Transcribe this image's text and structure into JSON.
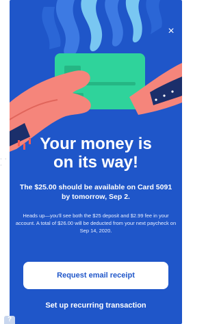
{
  "modal": {
    "close_icon": "×",
    "headline_line1": "Your money is",
    "headline_line2": "on its way!",
    "availability_text": "The $25.00 should be available on Card 5091 by tomorrow, Sep 2.",
    "notice_text": "Heads up—you'll see both the $25 deposit and $2.99 fee in your account. A total of $26.00 will be deducted from your next paycheck on Sep 14, 2020.",
    "primary_button_label": "Request email receipt",
    "secondary_link_label": "Set up recurring transaction"
  },
  "background": {
    "left_dots": "· · ·",
    "help_badge": "?"
  },
  "colors": {
    "modal_bg": "#1f56c9",
    "card_green": "#2fd39b",
    "hand_pink": "#f5857b",
    "sleeve_dark": "#1b2f6b",
    "flame_light": "#79c7f2"
  },
  "icons": {
    "close": "close-icon",
    "hand": "hand-illustration",
    "card": "card-illustration"
  }
}
